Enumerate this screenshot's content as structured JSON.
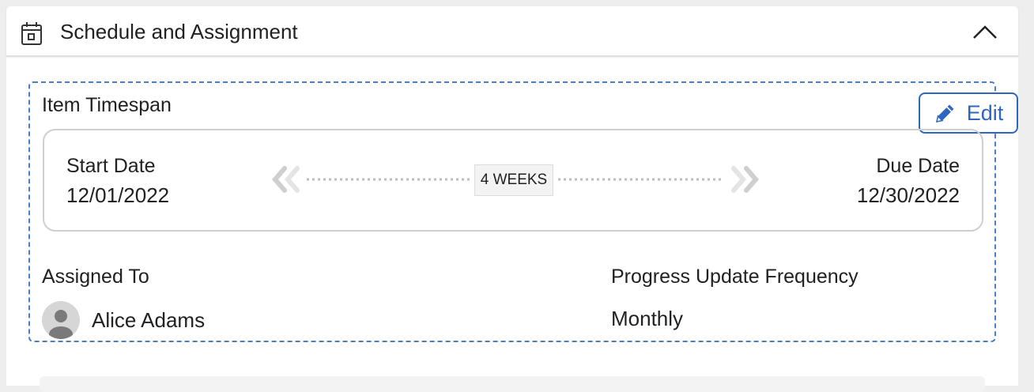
{
  "header": {
    "title": "Schedule and Assignment",
    "icon": "calendar-icon",
    "collapse_icon": "chevron-up-icon"
  },
  "timespan": {
    "title": "Item Timespan",
    "edit_label": "Edit",
    "edit_icon": "pencil-icon",
    "start_label": "Start Date",
    "start_value": "12/01/2022",
    "due_label": "Due Date",
    "due_value": "12/30/2022",
    "duration": "4 WEEKS"
  },
  "assignment": {
    "assigned_label": "Assigned To",
    "assignee": "Alice Adams",
    "avatar_icon": "user-avatar-icon",
    "frequency_label": "Progress Update Frequency",
    "frequency_value": "Monthly"
  },
  "colors": {
    "accent": "#2f66c2",
    "dashed_border": "#4a7fc1",
    "panel_border": "#cfcfcf"
  }
}
